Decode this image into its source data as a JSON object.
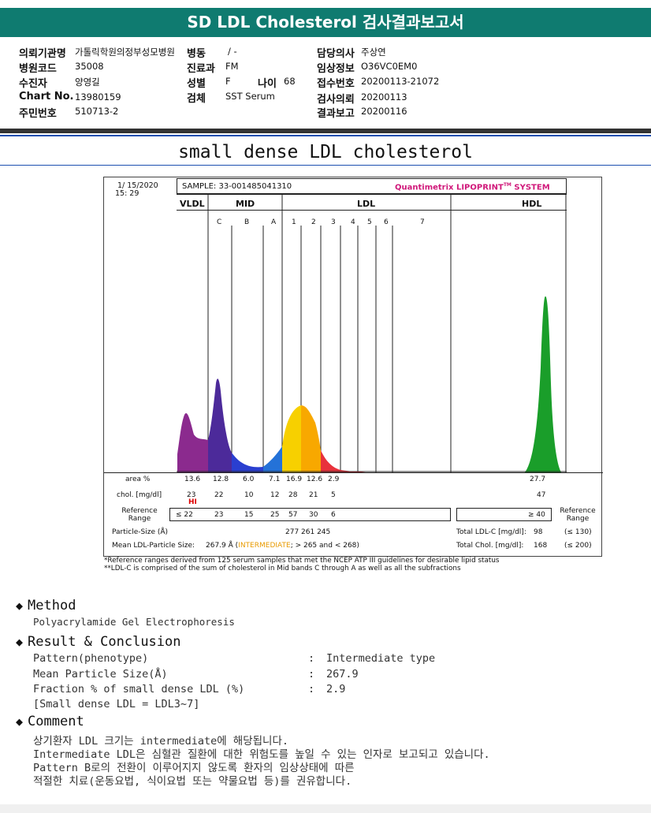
{
  "header": {
    "title": "SD LDL Cholesterol 검사결과보고서"
  },
  "info": {
    "institution_label": "의뢰기관명",
    "institution": "가톨릭학원의정부성모병원",
    "ward_label": "병동",
    "ward": "/ -",
    "doctor_label": "담당의사",
    "doctor": "주상연",
    "hospital_code_label": "병원코드",
    "hospital_code": "35008",
    "dept_label": "진료과",
    "dept": "FM",
    "clinical_label": "임상정보",
    "clinical": "O36VC0EM0",
    "patient_label": "수진자",
    "patient": "양영길",
    "sex_label": "성별",
    "sex": "F",
    "age_label": "나이",
    "age": "68",
    "receipt_label": "접수번호",
    "receipt": "20200113-21072",
    "chart_label": "Chart No.",
    "chart": "13980159",
    "specimen_label": "검체",
    "specimen": "SST Serum",
    "request_label": "검사의뢰",
    "request": "20200113",
    "id_label": "주민번호",
    "id": "510713-2",
    "result_date_label": "결과보고",
    "result_date": "20200116"
  },
  "subtitle": "small dense LDL cholesterol",
  "report": {
    "date": "1/ 15/2020",
    "time": "15: 29",
    "sample": "SAMPLE:  33-001485041310",
    "brand": "Quantimetrix LIPOPRINT",
    "brand_tm": "TM",
    "brand_sys": "SYSTEM",
    "groups": {
      "vldl": "VLDL",
      "mid": "MID",
      "ldl": "LDL",
      "hdl": "HDL"
    },
    "bands": [
      "C",
      "B",
      "A",
      "1",
      "2",
      "3",
      "4",
      "5",
      "6",
      "7"
    ],
    "row_labels": {
      "area": "area %",
      "chol": "chol. [mg/dl]",
      "ref": "Reference Range",
      "size": "Particle-Size (Å)",
      "mean": "Mean LDL-Particle Size:"
    },
    "area": [
      "13.6",
      "12.8",
      "6.0",
      "7.1",
      "16.9",
      "12.6",
      "2.9"
    ],
    "chol": [
      "23",
      "22",
      "10",
      "12",
      "28",
      "21",
      "5"
    ],
    "hi_flag": "HI",
    "ref": [
      "≤ 22",
      "23",
      "15",
      "25",
      "57",
      "30",
      "6"
    ],
    "hdl_area": "27.7",
    "hdl_chol": "47",
    "hdl_ref": "≥ 40",
    "ref_range_label": "Reference Range",
    "sizes": "277   261   245",
    "mean_value": "267.9 Å",
    "mean_type": "INTERMEDIATE",
    "mean_rest": "; > 265 and < 268)",
    "total_ldl_label": "Total LDL-C [mg/dl]:",
    "total_ldl": "98",
    "total_ldl_ref": "(≤ 130)",
    "total_chol_label": "Total Chol. [mg/dl]:",
    "total_chol": "168",
    "total_chol_ref": "(≤ 200)",
    "footnote1": "*Reference ranges derived from 125 serum samples that met the NCEP ATP III guidelines for desirable lipid status",
    "footnote2": "**LDL-C is comprised of the sum of cholesterol in Mid bands C through A as well as all the subfractions",
    "colors": {
      "vldl": "#8b2a8e",
      "c": "#4c2a9a",
      "b": "#2a3fd0",
      "a": "#2472d8",
      "l1": "#f7d000",
      "l2": "#f8a800",
      "l3": "#e8323c",
      "hdl": "#1a9e2a"
    }
  },
  "method": {
    "title": "Method",
    "text": "Polyacrylamide Gel Electrophoresis"
  },
  "result": {
    "title": "Result & Conclusion",
    "rows": [
      {
        "label": "Pattern(phenotype)",
        "colon": ":",
        "value": "Intermediate type"
      },
      {
        "label": "Mean Particle Size(Å)",
        "colon": ":",
        "value": "267.9"
      },
      {
        "label": "Fraction % of small dense LDL (%)",
        "colon": ":",
        "value": "2.9"
      }
    ],
    "note": "[Small dense LDL = LDL3~7]"
  },
  "comment": {
    "title": "Comment",
    "lines": [
      "상기환자 LDL 크기는 intermediate에 해당됩니다.",
      "Intermediate LDL은 심혈관 질환에 대한 위험도를 높일 수 있는 인자로 보고되고 있습니다.",
      "Pattern B로의 전환이 이루어지지 않도록 환자의 임상상태에 따른",
      "적절한 치료(운동요법, 식이요법 또는 약물요법 등)를 권유합니다."
    ]
  }
}
